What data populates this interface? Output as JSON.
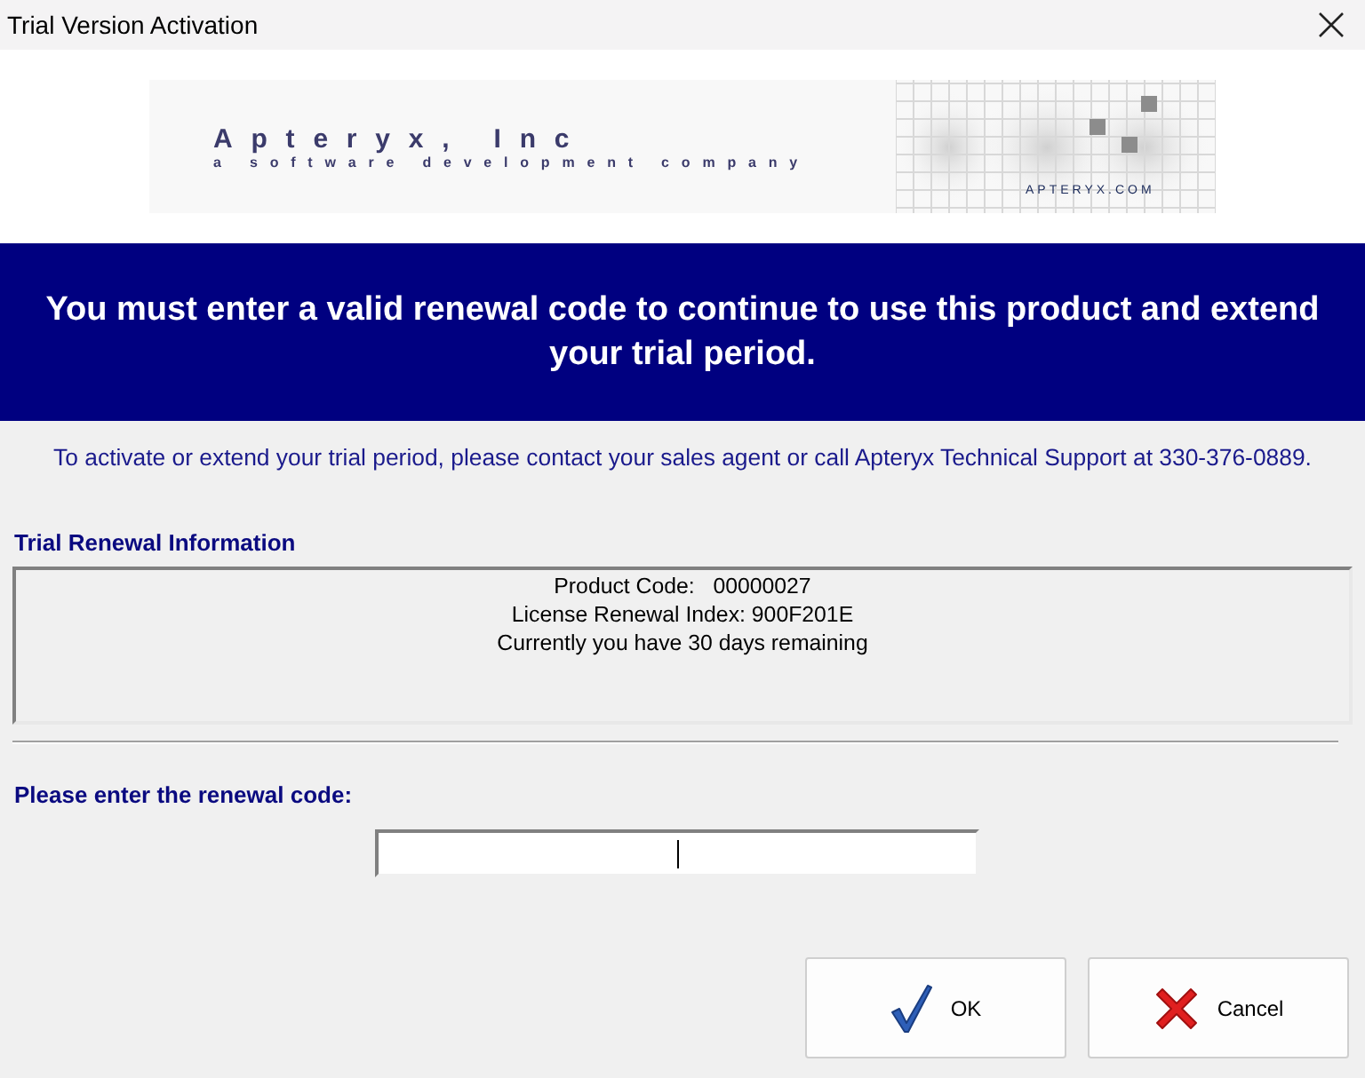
{
  "window": {
    "title": "Trial Version Activation"
  },
  "banner": {
    "company": "Apteryx, Inc",
    "tagline": "a software development company",
    "website": "APTERYX.COM"
  },
  "headline": "You must enter a valid renewal code to continue to use this product and extend your trial period.",
  "contact_note": "To activate or extend your trial period, please contact your sales agent or call Apteryx Technical Support at 330-376-0889.",
  "renewal_info": {
    "heading": "Trial Renewal Information",
    "lines": [
      "Product Code:   00000027",
      "License Renewal Index: 900F201E",
      "Currently you have 30 days remaining"
    ]
  },
  "code_entry": {
    "label": "Please enter the renewal code:",
    "focused": true
  },
  "buttons": [
    {
      "label": "OK",
      "kind": "ok"
    },
    {
      "label": "Cancel",
      "kind": "cancel"
    }
  ]
}
